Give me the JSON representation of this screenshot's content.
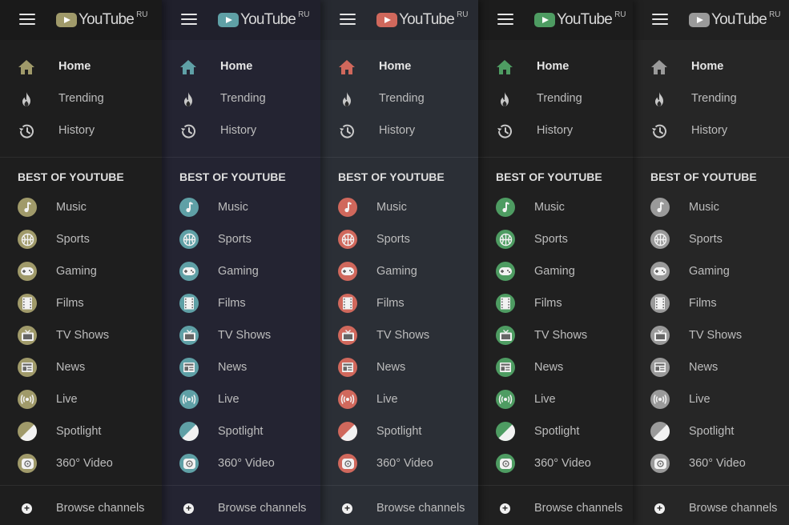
{
  "app": {
    "logo_text": "YouTube",
    "region_badge": "RU"
  },
  "nav": {
    "items": [
      {
        "label": "Home",
        "icon": "home-icon",
        "active": true
      },
      {
        "label": "Trending",
        "icon": "flame-icon",
        "active": false
      },
      {
        "label": "History",
        "icon": "history-icon",
        "active": false
      }
    ]
  },
  "best_of": {
    "title": "BEST OF YOUTUBE",
    "items": [
      {
        "label": "Music",
        "icon": "music-note-icon"
      },
      {
        "label": "Sports",
        "icon": "basketball-icon"
      },
      {
        "label": "Gaming",
        "icon": "gamepad-icon"
      },
      {
        "label": "Films",
        "icon": "film-icon"
      },
      {
        "label": "TV Shows",
        "icon": "tv-icon"
      },
      {
        "label": "News",
        "icon": "newspaper-icon"
      },
      {
        "label": "Live",
        "icon": "live-broadcast-icon"
      },
      {
        "label": "Spotlight",
        "icon": "spotlight-icon"
      },
      {
        "label": "360° Video",
        "icon": "360-video-icon"
      }
    ]
  },
  "footer": {
    "browse_label": "Browse channels",
    "browse_icon": "plus-circle-icon"
  },
  "themes": [
    {
      "name": "olive",
      "accent": "#a09a6a",
      "bg": "#1e1e1e",
      "header": "#1a1a1a"
    },
    {
      "name": "teal",
      "accent": "#5fa0a6",
      "bg": "#242432",
      "header": "#20202c"
    },
    {
      "name": "red",
      "accent": "#d0685c",
      "bg": "#2b2f36",
      "header": "#272a31"
    },
    {
      "name": "green",
      "accent": "#4e9c62",
      "bg": "#202020",
      "header": "#1c1c1c"
    },
    {
      "name": "grey",
      "accent": "#9a9a9a",
      "bg": "#262626",
      "header": "#212121"
    }
  ]
}
